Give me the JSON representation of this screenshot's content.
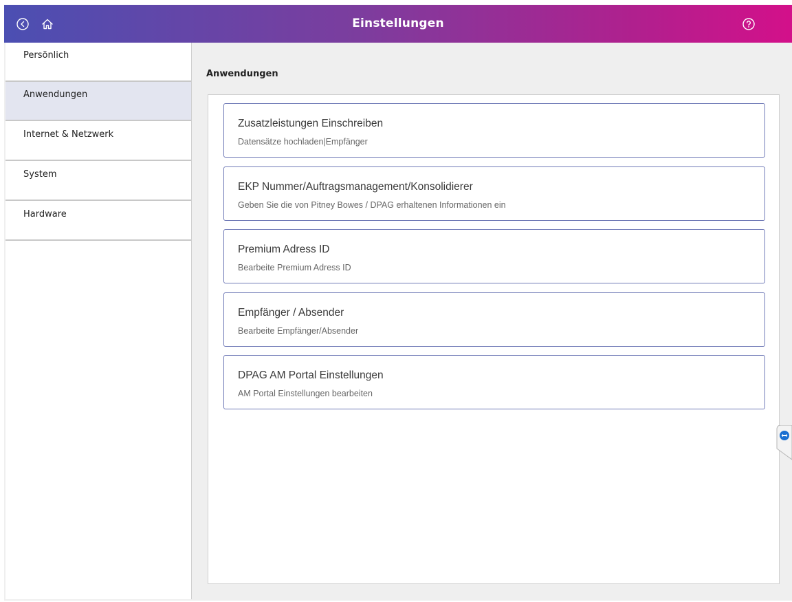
{
  "header": {
    "title": "Einstellungen",
    "back_icon": "back-circle-icon",
    "home_icon": "home-icon",
    "help_icon": "help-circle-icon"
  },
  "sidebar": {
    "items": [
      {
        "label": "Persönlich",
        "active": false
      },
      {
        "label": "Anwendungen",
        "active": true
      },
      {
        "label": "Internet & Netzwerk",
        "active": false
      },
      {
        "label": "System",
        "active": false
      },
      {
        "label": "Hardware",
        "active": false
      }
    ]
  },
  "main": {
    "section_title": "Anwendungen",
    "cards": [
      {
        "title": "Zusatzleistungen Einschreiben",
        "subtitle": "Datensätze hochladen|Empfänger"
      },
      {
        "title": "EKP Nummer/Auftragsmanagement/Konsolidierer",
        "subtitle": "Geben Sie die von Pitney Bowes / DPAG erhaltenen Informationen ein"
      },
      {
        "title": "Premium Adress ID",
        "subtitle": "Bearbeite Premium Adress ID"
      },
      {
        "title": "Empfänger / Absender",
        "subtitle": "Bearbeite Empfänger/Absender"
      },
      {
        "title": "DPAG AM Portal Einstellungen",
        "subtitle": "AM Portal Einstellungen bearbeiten"
      }
    ]
  },
  "colors": {
    "accent_start": "#4b4fb2",
    "accent_end": "#d3108a",
    "card_border": "#6f79b6",
    "active_nav_bg": "#e3e5f0"
  },
  "side_widget": {
    "icon": "teamviewer-icon"
  }
}
